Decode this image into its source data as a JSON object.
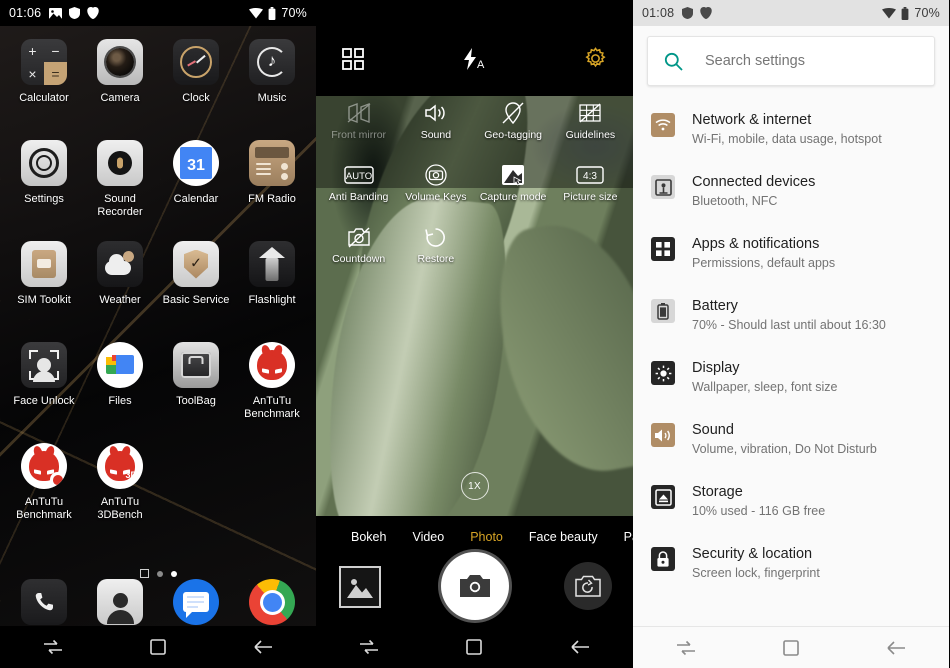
{
  "home": {
    "status": {
      "time": "01:06",
      "battery": "70%",
      "left_icons": [
        "screenshot-icon",
        "shield-icon",
        "app-icon"
      ],
      "right_icons": [
        "wifi-icon",
        "battery-icon"
      ]
    },
    "apps": [
      {
        "label": "Calculator",
        "icon": "calculator-icon",
        "keys": [
          "+",
          "−",
          "×",
          "="
        ]
      },
      {
        "label": "Camera",
        "icon": "camera-icon"
      },
      {
        "label": "Clock",
        "icon": "clock-icon"
      },
      {
        "label": "Music",
        "icon": "music-icon"
      },
      {
        "label": "Settings",
        "icon": "settings-icon"
      },
      {
        "label": "Sound Recorder",
        "icon": "sound-recorder-icon"
      },
      {
        "label": "Calendar",
        "icon": "calendar-icon",
        "day": "31"
      },
      {
        "label": "FM Radio",
        "icon": "fm-radio-icon"
      },
      {
        "label": "SIM Toolkit",
        "icon": "sim-toolkit-icon"
      },
      {
        "label": "Weather",
        "icon": "weather-icon"
      },
      {
        "label": "Basic Service",
        "icon": "basic-service-icon"
      },
      {
        "label": "Flashlight",
        "icon": "flashlight-icon"
      },
      {
        "label": "Face Unlock",
        "icon": "face-unlock-icon"
      },
      {
        "label": "Files",
        "icon": "files-icon"
      },
      {
        "label": "ToolBag",
        "icon": "toolbag-icon"
      },
      {
        "label": "AnTuTu Benchmark",
        "icon": "antutu-icon"
      },
      {
        "label": "AnTuTu Benchmark",
        "icon": "antutu-icon"
      },
      {
        "label": "AnTuTu 3DBench",
        "icon": "antutu-3d-icon",
        "badge": "3D"
      }
    ],
    "dock": [
      {
        "label": "Phone",
        "icon": "phone-icon"
      },
      {
        "label": "Contacts",
        "icon": "contacts-icon"
      },
      {
        "label": "Messages",
        "icon": "messages-icon"
      },
      {
        "label": "Chrome",
        "icon": "chrome-icon"
      }
    ],
    "page_indicator": {
      "pages": 3,
      "current": 3
    }
  },
  "camera": {
    "topbar": {
      "modes_icon": "grid-icon",
      "flash": "flash-auto-icon",
      "settings_icon": "gear-icon",
      "settings_color": "#d8a526"
    },
    "settings_overlay": [
      {
        "label": "Front mirror",
        "icon": "front-mirror-off-icon",
        "dim": true
      },
      {
        "label": "Sound",
        "icon": "sound-on-icon",
        "dim": false
      },
      {
        "label": "Geo-tagging",
        "icon": "geo-tagging-off-icon",
        "dim": false
      },
      {
        "label": "Guidelines",
        "icon": "guidelines-icon",
        "dim": false
      },
      {
        "label": "Anti Banding",
        "icon": "anti-banding-auto-icon",
        "dim": false
      },
      {
        "label": "Volume Keys",
        "icon": "volume-keys-icon",
        "dim": false
      },
      {
        "label": "Capture mode",
        "icon": "capture-mode-icon",
        "dim": false
      },
      {
        "label": "Picture size",
        "icon": "picture-size-icon",
        "dim": false
      },
      {
        "label": "Countdown",
        "icon": "countdown-off-icon",
        "dim": false
      },
      {
        "label": "Restore",
        "icon": "restore-icon",
        "dim": false
      }
    ],
    "zoom_badge": "1X",
    "modes": [
      {
        "label": "Bokeh",
        "active": false
      },
      {
        "label": "Video",
        "active": false
      },
      {
        "label": "Photo",
        "active": true
      },
      {
        "label": "Face beauty",
        "active": false
      },
      {
        "label": "Panorama",
        "active": false
      }
    ],
    "active_mode_color": "#d8a526",
    "controls": {
      "gallery": "gallery-thumbnail-button",
      "shutter": "shutter-button",
      "flip": "switch-camera-button"
    }
  },
  "settings": {
    "status": {
      "time": "01:08",
      "battery": "70%",
      "left_icons": [
        "shield-icon",
        "app-icon"
      ],
      "right_icons": [
        "wifi-icon",
        "battery-icon"
      ]
    },
    "search": {
      "placeholder": "Search settings",
      "icon": "search-icon",
      "icon_color": "#009688"
    },
    "items": [
      {
        "title": "Network & internet",
        "subtitle": "Wi-Fi, mobile, data usage, hotspot",
        "icon": "wifi-icon",
        "color": "#b08d66"
      },
      {
        "title": "Connected devices",
        "subtitle": "Bluetooth, NFC",
        "icon": "connected-devices-icon",
        "color": "#d7d7d7"
      },
      {
        "title": "Apps & notifications",
        "subtitle": "Permissions, default apps",
        "icon": "apps-icon",
        "color": "#262626"
      },
      {
        "title": "Battery",
        "subtitle": "70% - Should last until about 16:30",
        "icon": "battery-icon",
        "color": "#d7d7d7"
      },
      {
        "title": "Display",
        "subtitle": "Wallpaper, sleep, font size",
        "icon": "display-icon",
        "color": "#262626"
      },
      {
        "title": "Sound",
        "subtitle": "Volume, vibration, Do Not Disturb",
        "icon": "sound-icon",
        "color": "#b08d66"
      },
      {
        "title": "Storage",
        "subtitle": "10% used - 116 GB free",
        "icon": "storage-icon",
        "color": "#262626"
      },
      {
        "title": "Security & location",
        "subtitle": "Screen lock, fingerprint",
        "icon": "lock-icon",
        "color": "#262626"
      }
    ]
  },
  "navbar": {
    "recent": "recents-icon",
    "home": "home-icon",
    "back": "back-icon"
  }
}
